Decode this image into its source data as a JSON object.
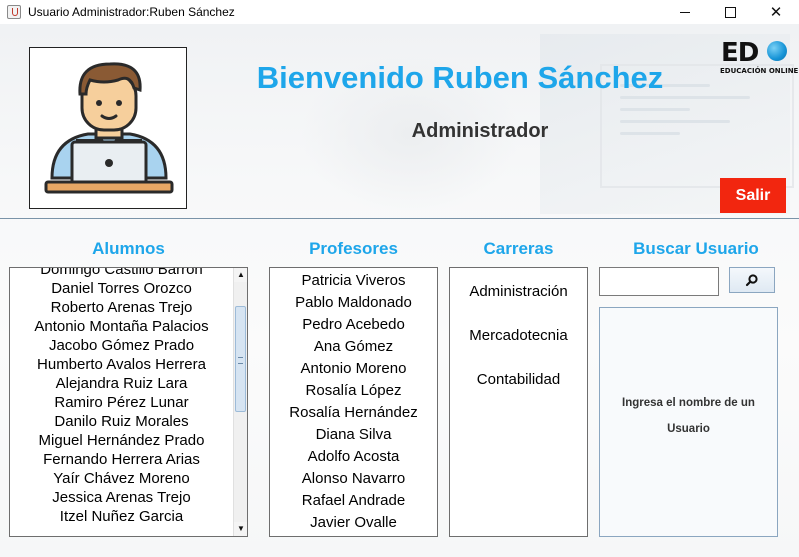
{
  "window": {
    "title": "Usuario Administrador:Ruben Sánchez",
    "controls": {
      "minimize_icon": "minimize-icon",
      "maximize_icon": "maximize-icon",
      "close_icon": "close-icon"
    }
  },
  "header": {
    "welcome": "Bienvenido Ruben Sánchez",
    "role": "Administrador",
    "logo": {
      "letters": "ED",
      "subtitle": "EDUCACIÓN ONLINE"
    },
    "exit_label": "Salir",
    "avatar_icon": "user-at-laptop-icon"
  },
  "colors": {
    "accent": "#1ea6ea",
    "exit_button": "#f2260f"
  },
  "sections": {
    "alumnos_title": "Alumnos",
    "profesores_title": "Profesores",
    "carreras_title": "Carreras",
    "buscar_title": "Buscar Usuario"
  },
  "alumnos": [
    "Domingo Castillo Barrón",
    "Daniel Torres Orozco",
    "Roberto Arenas Trejo",
    "Antonio Montaña Palacios",
    "Jacobo  Gómez Prado",
    "Humberto Avalos Herrera",
    "Alejandra Ruiz Lara",
    "Ramiro  Pérez Lunar",
    "Danilo Ruiz Morales",
    "Miguel Hernández Prado",
    "Fernando Herrera Arias",
    "Yaír Chávez Moreno",
    "Jessica Arenas Trejo",
    "Itzel Nuñez Garcia"
  ],
  "profesores": [
    "Patricia Viveros",
    "Pablo Maldonado",
    "Pedro Acebedo",
    "Ana Gómez",
    "Antonio Moreno",
    "Rosalía López",
    "Rosalía Hernández",
    "Diana Silva",
    "Adolfo Acosta",
    "Alonso Navarro",
    "Rafael Andrade",
    "Javier Ovalle"
  ],
  "carreras": [
    "Administración",
    "Mercadotecnia",
    "Contabilidad"
  ],
  "search": {
    "value": "",
    "button_icon": "search-icon",
    "result_message": "Ingresa el nombre de un Usuario"
  }
}
